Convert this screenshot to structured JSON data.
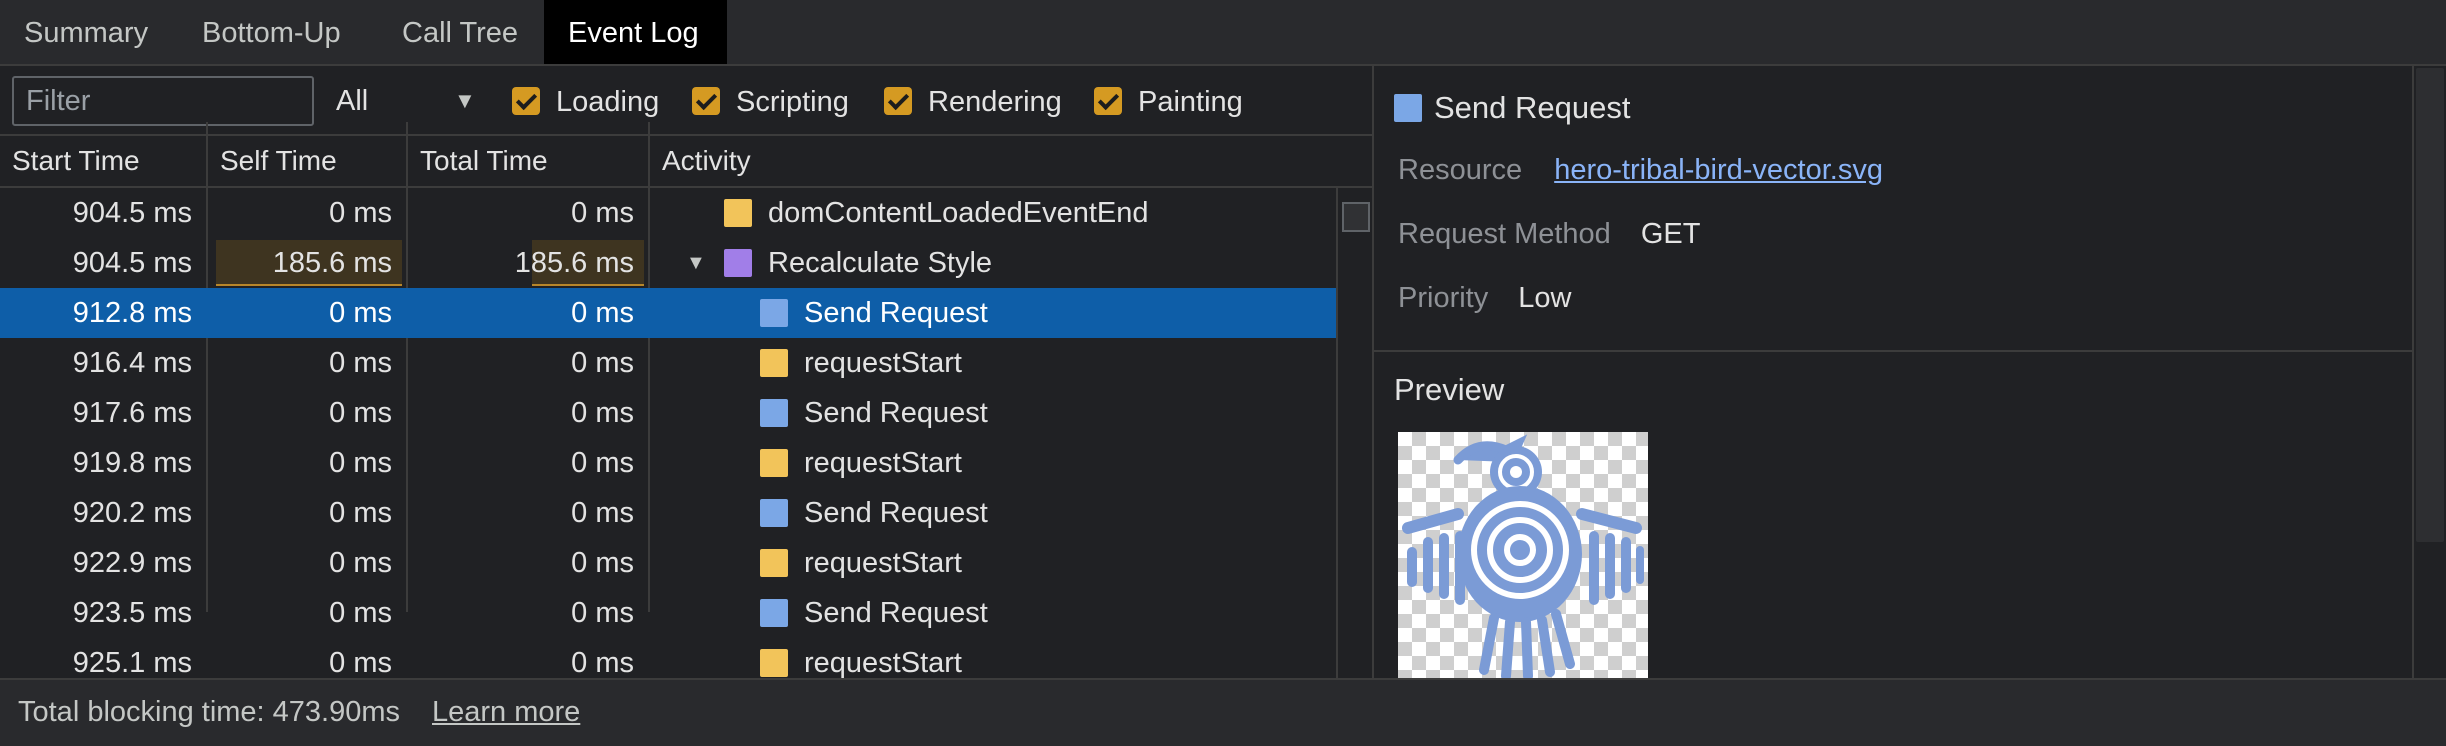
{
  "tabs": [
    "Summary",
    "Bottom-Up",
    "Call Tree",
    "Event Log"
  ],
  "active_tab": "Event Log",
  "filter": {
    "placeholder": "Filter",
    "value": ""
  },
  "select": {
    "value": "All"
  },
  "checkboxes": [
    {
      "label": "Loading",
      "checked": true
    },
    {
      "label": "Scripting",
      "checked": true
    },
    {
      "label": "Rendering",
      "checked": true
    },
    {
      "label": "Painting",
      "checked": true
    }
  ],
  "columns": {
    "start": "Start Time",
    "self": "Self Time",
    "total": "Total Time",
    "activity": "Activity"
  },
  "rows": [
    {
      "start": "904.5 ms",
      "self": "0 ms",
      "total": "0 ms",
      "activity": "domContentLoadedEventEnd",
      "color": "#f2c45a"
    },
    {
      "start": "904.5 ms",
      "self": "185.6 ms",
      "total": "185.6 ms",
      "activity": "Recalculate Style",
      "color": "#a17ee8"
    },
    {
      "start": "912.8 ms",
      "self": "0 ms",
      "total": "0 ms",
      "activity": "Send Request",
      "color": "#7ba7e6"
    },
    {
      "start": "916.4 ms",
      "self": "0 ms",
      "total": "0 ms",
      "activity": "requestStart",
      "color": "#f2c45a"
    },
    {
      "start": "917.6 ms",
      "self": "0 ms",
      "total": "0 ms",
      "activity": "Send Request",
      "color": "#7ba7e6"
    },
    {
      "start": "919.8 ms",
      "self": "0 ms",
      "total": "0 ms",
      "activity": "requestStart",
      "color": "#f2c45a"
    },
    {
      "start": "920.2 ms",
      "self": "0 ms",
      "total": "0 ms",
      "activity": "Send Request",
      "color": "#7ba7e6"
    },
    {
      "start": "922.9 ms",
      "self": "0 ms",
      "total": "0 ms",
      "activity": "requestStart",
      "color": "#f2c45a"
    },
    {
      "start": "923.5 ms",
      "self": "0 ms",
      "total": "0 ms",
      "activity": "Send Request",
      "color": "#7ba7e6"
    },
    {
      "start": "925.1 ms",
      "self": "0 ms",
      "total": "0 ms",
      "activity": "requestStart",
      "color": "#f2c45a"
    }
  ],
  "detail": {
    "title": "Send Request",
    "resource_label": "Resource",
    "resource_value": "hero-tribal-bird-vector.svg",
    "method_label": "Request Method",
    "method_value": "GET",
    "priority_label": "Priority",
    "priority_value": "Low",
    "preview_label": "Preview"
  },
  "footer": {
    "text": "Total blocking time: 473.90ms",
    "link": "Learn more"
  }
}
